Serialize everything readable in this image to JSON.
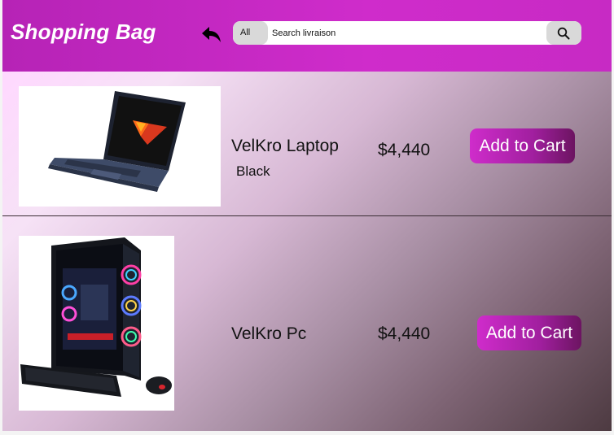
{
  "header": {
    "title": "Shopping Bag",
    "back_icon": "undo-arrow-icon",
    "search": {
      "category": "All",
      "placeholder": "Search livraison",
      "button_icon": "search-icon"
    }
  },
  "products": [
    {
      "name": "VelKro Laptop",
      "color": "Black",
      "price": "$4,440",
      "cta": "Add to Cart",
      "image_icon": "laptop-icon"
    },
    {
      "name": "VelKro Pc",
      "price": "$4,440",
      "cta": "Add to Cart",
      "image_icon": "desktop-pc-icon"
    }
  ],
  "colors": {
    "header": "#cf2ccb",
    "button": "#a11f9f"
  }
}
